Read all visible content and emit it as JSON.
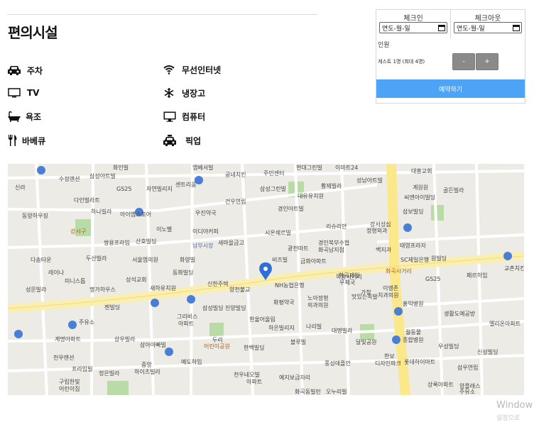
{
  "facilities": {
    "title": "편의시설",
    "items": [
      {
        "icon": "car-icon",
        "label": "주차"
      },
      {
        "icon": "wifi-icon",
        "label": "무선인터넷"
      },
      {
        "icon": "tv-icon",
        "label": "TV"
      },
      {
        "icon": "snowflake-icon",
        "label": "냉장고"
      },
      {
        "icon": "bathtub-icon",
        "label": "욕조"
      },
      {
        "icon": "monitor-icon",
        "label": "컴퓨터"
      },
      {
        "icon": "utensils-icon",
        "label": "바베큐"
      },
      {
        "icon": "taxi-icon",
        "label": "픽업"
      }
    ]
  },
  "booking": {
    "checkin_label": "체크인",
    "checkout_label": "체크아웃",
    "checkin_value": "연도-월-일",
    "checkout_value": "연도-월-일",
    "guests_label": "인원",
    "guests_text": "게스트 1명 (최대 4명)",
    "decrement_label": "-",
    "increment_label": "+",
    "reserve_label": "예약하기",
    "accent_color": "#4da3f5"
  },
  "map": {
    "labels": [
      "화인빌",
      "엠베서빌",
      "굽네치킨",
      "주민센터",
      "현대그린빌",
      "이마트24",
      "대흥교회",
      "신라",
      "수정맨션",
      "삼성아트빌",
      "삼성그린빌",
      "황제빌라",
      "성남아트빌",
      "계원원",
      "골든빌라",
      "GS25",
      "자연빌리지",
      "센트리움",
      "대유유치원",
      "씨엔아이빌딩",
      "다인빌라트",
      "하나빌라",
      "아이엠스토어",
      "건우연립",
      "경인아트빌",
      "우진약국",
      "삼보빌딩",
      "동양하우징",
      "이노벨",
      "이디야커피",
      "시온쉐르빌",
      "리슈리안",
      "강서성심",
      "정형외과",
      "강서구",
      "쌍용프라임",
      "산호빌딩",
      "남부시장",
      "새마을금고",
      "광천마트",
      "경인북부수협",
      "화곡남지점",
      "백지과",
      "태영프라자",
      "다솜타운",
      "두산빌라",
      "서울엠의원",
      "화양빌",
      "비즈빌",
      "금화아파트",
      "화곡사거리",
      "SC제일은행",
      "원빌딩",
      "레이나",
      "미니스톱",
      "동화빌딩",
      "목동사거리",
      "패르하임",
      "성문빌라",
      "명가하우스",
      "성석교회",
      "새하유치원",
      "신한주택",
      "양천불교",
      "NH농협은행",
      "화곡제일",
      "우체국",
      "가창",
      "이엥존",
      "치과의원",
      "GS25",
      "교촌치킨",
      "젠빌딩",
      "그리비스",
      "아파트",
      "삼성빌딩",
      "진양빌딩",
      "화평약국",
      "노아정형",
      "외과의원",
      "맛있는족발",
      "홍익병원",
      "생활도예공방",
      "주유소",
      "한울어울림",
      "하은빌리지",
      "나리빌",
      "대명빌라",
      "달빛공원",
      "월동물",
      "종합병원",
      "엘리온아파트",
      "계명아파트",
      "상우빌라",
      "삼아아빠빌",
      "두리",
      "어린이공원",
      "한백빌딩",
      "블루빌",
      "한보",
      "디자인파크",
      "우성빌딩",
      "신성빌딩",
      "천우맨션",
      "예도하임",
      "풍성애플안",
      "롯데하이마트",
      "삼우연립",
      "프라임빌",
      "정은빌라",
      "중앙",
      "하이츠빌라",
      "천우네오빌",
      "아파트",
      "예지보금자리",
      "상록아파트",
      "양플래스",
      "구립한빛",
      "어린이집",
      "화곡동빌린",
      "오누리빌",
      "주유소"
    ]
  },
  "watermark": {
    "line1": "Window",
    "line2": "설정으로"
  }
}
